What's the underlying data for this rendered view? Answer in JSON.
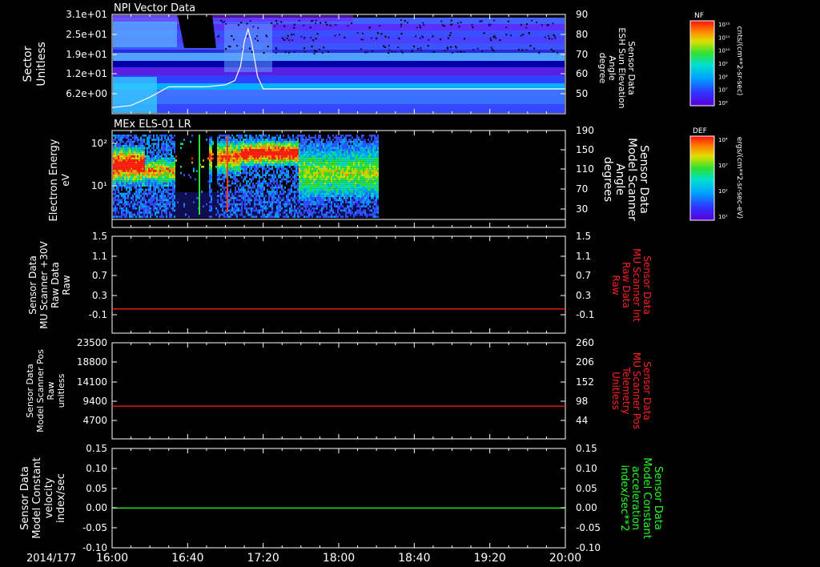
{
  "date": "2014/177",
  "time_ticks": [
    "16:00",
    "16:40",
    "17:20",
    "18:00",
    "18:40",
    "19:20",
    "20:00"
  ],
  "colors": {
    "red": "#ff2020",
    "green": "#22ff22",
    "white": "#ffffff"
  },
  "chart_data": [
    {
      "type": "heatmap",
      "title": "NPI Vector Data",
      "left_axis": {
        "label": [
          "Sector",
          "Unitless"
        ],
        "ticks": [
          "3.1e+01",
          "2.5e+01",
          "1.9e+01",
          "1.2e+01",
          "6.2e+00"
        ],
        "ylim": [
          0,
          31
        ]
      },
      "right_axis": {
        "label": [
          "Sensor Data",
          "ESH Sun Elevation",
          "Angle",
          "degree"
        ],
        "ticks": [
          "90",
          "80",
          "70",
          "60",
          "50"
        ],
        "ylim": [
          42,
          90
        ]
      },
      "overlay_series": {
        "name": "ESH Sun Elevation Angle",
        "color": "#ffffff",
        "x": [
          "16:00",
          "16:10",
          "16:20",
          "16:30",
          "16:40",
          "16:50",
          "17:00",
          "17:05",
          "17:08",
          "17:10",
          "17:12",
          "17:14",
          "17:17",
          "17:20",
          "17:30",
          "18:00",
          "19:00",
          "20:00"
        ],
        "y": [
          45,
          46,
          50,
          55,
          55,
          55,
          56,
          58,
          65,
          77,
          83,
          76,
          60,
          54,
          54,
          54,
          54,
          54
        ]
      },
      "colorbar": {
        "label": "NF",
        "top": "10¹²",
        "units": "cnts/(cm**2-sr-sec)",
        "ticks": [
          "10¹²",
          "10¹¹",
          "10¹⁰",
          "10⁹",
          "10⁸",
          "10⁷",
          "10⁶"
        ]
      }
    },
    {
      "type": "heatmap",
      "title": "MEx ELS-01 LR",
      "left_axis": {
        "label": [
          "Electron Energy",
          "eV"
        ],
        "ticks": [
          "10²",
          "10¹"
        ],
        "log": true
      },
      "right_axis": {
        "label": [
          "Sensor Data",
          "Model Scanner",
          "Angle",
          "degrees"
        ],
        "ticks": [
          "190",
          "150",
          "110",
          "70",
          "30"
        ],
        "ylim": [
          10,
          190
        ]
      },
      "colorbar": {
        "label": "DEF",
        "units": "ergs/(cm**2-sr-sec-eV)",
        "ticks": [
          "10⁴",
          "10³",
          "10²",
          "10¹"
        ]
      }
    },
    {
      "type": "line",
      "left_axis": {
        "label": [
          "Sensor Data",
          "MU Scanner +30V",
          "Raw Data",
          "Raw"
        ],
        "ticks": [
          "1.5",
          "1.1",
          "0.7",
          "0.3",
          "-0.1"
        ],
        "ylim": [
          -0.5,
          1.5
        ]
      },
      "right_axis": {
        "label": [
          "Sensor Data",
          "MU Scanner Int",
          "Raw Data",
          "Raw"
        ],
        "ticks": [
          "1.5",
          "1.1",
          "0.7",
          "0.3",
          "-0.1"
        ],
        "ylim": [
          -0.5,
          1.5
        ]
      },
      "series": [
        {
          "color": "#ff2020",
          "x": [
            "16:00",
            "20:00"
          ],
          "y": [
            0,
            0
          ]
        }
      ]
    },
    {
      "type": "line",
      "left_axis": {
        "label": [
          "Sensor Data",
          "Model Scanner Pos",
          "Raw",
          "unitless"
        ],
        "ticks": [
          "23500",
          "18800",
          "14100",
          "9400",
          "4700"
        ],
        "ylim": [
          0,
          23500
        ]
      },
      "right_axis": {
        "label": [
          "Sensor Data",
          "MU Scanner Pos",
          "Telemetry",
          "Unitless"
        ],
        "ticks": [
          "260",
          "206",
          "152",
          "98",
          "44"
        ],
        "ylim": [
          0,
          260
        ]
      },
      "series": [
        {
          "color": "#ff2020",
          "x": [
            "16:00",
            "20:00"
          ],
          "y": [
            8000,
            8000
          ]
        }
      ]
    },
    {
      "type": "line",
      "left_axis": {
        "label": [
          "Sensor Data",
          "Model Constant",
          "velocity",
          "index/sec"
        ],
        "ticks": [
          "0.15",
          "0.10",
          "0.05",
          "0.00",
          "-0.05",
          "-0.10"
        ],
        "ylim": [
          -0.1,
          0.15
        ]
      },
      "right_axis": {
        "label": [
          "Sensor Data",
          "Model Constant",
          "acceleration",
          "index/sec**2"
        ],
        "ticks": [
          "0.15",
          "0.10",
          "0.05",
          "0.00",
          "-0.05",
          "-0.10"
        ],
        "ylim": [
          -0.1,
          0.15
        ]
      },
      "series": [
        {
          "color": "#22ff22",
          "x": [
            "16:00",
            "20:00"
          ],
          "y": [
            0,
            0
          ]
        }
      ]
    }
  ]
}
